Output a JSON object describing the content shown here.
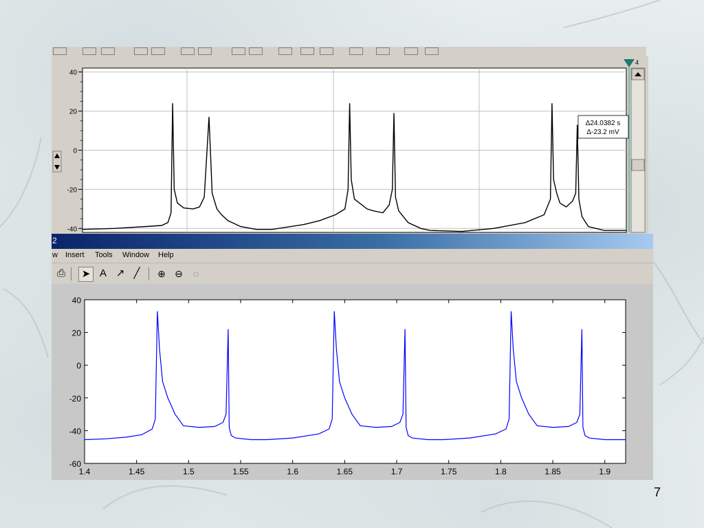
{
  "slide": {
    "number": "7"
  },
  "top_window": {
    "cursor_number": "4",
    "measurement": {
      "dt": "Δ24.0382 s",
      "dv": "Δ-23.2 mV"
    }
  },
  "matlab_window": {
    "title": "2",
    "menu": [
      "w",
      "Insert",
      "Tools",
      "Window",
      "Help"
    ],
    "toolbar": [
      "print-icon",
      "select-arrow-icon",
      "text-icon",
      "arrow-icon",
      "line-icon",
      "zoom-in-icon",
      "zoom-out-icon",
      "rotate-icon"
    ]
  },
  "chart_data": [
    {
      "type": "line",
      "title": "",
      "xlabel": "",
      "ylabel": "",
      "ylim": [
        -42,
        42
      ],
      "yticks": [
        40,
        20,
        0,
        -20,
        -40
      ],
      "grid": true,
      "color": "#000000",
      "x": [
        0.0,
        0.1,
        0.2,
        0.25,
        0.27,
        0.28,
        0.285,
        0.29,
        0.3,
        0.32,
        0.35,
        0.37,
        0.385,
        0.4,
        0.41,
        0.425,
        0.44,
        0.46,
        0.5,
        0.55,
        0.6,
        0.7,
        0.75,
        0.8,
        0.83,
        0.84,
        0.845,
        0.85,
        0.86,
        0.9,
        0.92,
        0.95,
        0.97,
        0.98,
        0.985,
        0.99,
        1.0,
        1.03,
        1.07,
        1.1,
        1.2,
        1.3,
        1.4,
        1.46,
        1.48,
        1.485,
        1.49,
        1.5,
        1.51,
        1.53,
        1.55,
        1.56,
        1.565,
        1.57,
        1.58,
        1.6,
        1.65,
        1.7,
        1.72
      ],
      "y": [
        -40.5,
        -40,
        -39,
        -38.5,
        -37,
        -32,
        24,
        -20,
        -27,
        -29.5,
        -30,
        -29,
        -24,
        17,
        -22,
        -30,
        -33,
        -36,
        -39,
        -40.5,
        -40.5,
        -38,
        -36,
        -33,
        -30,
        -20,
        24,
        -15,
        -25,
        -30,
        -31,
        -32,
        -28,
        -20,
        19,
        -24,
        -31,
        -37,
        -40,
        -41,
        -41.5,
        -40,
        -37,
        -33,
        -25,
        24,
        -15,
        -22,
        -27,
        -29,
        -26,
        -22,
        13,
        -25,
        -34,
        -39,
        -41,
        -41,
        -41
      ]
    },
    {
      "type": "line",
      "title": "",
      "xlabel": "",
      "ylabel": "",
      "xlim": [
        1.4,
        1.92
      ],
      "ylim": [
        -60,
        40
      ],
      "xticks": [
        "1.4",
        "1.45",
        "1.5",
        "1.55",
        "1.6",
        "1.65",
        "1.7",
        "1.75",
        "1.8",
        "1.85",
        "1.9"
      ],
      "yticks": [
        "40",
        "20",
        "0",
        "-20",
        "-40",
        "-60"
      ],
      "grid": false,
      "color": "#0000ff",
      "x": [
        1.4,
        1.42,
        1.44,
        1.455,
        1.465,
        1.468,
        1.47,
        1.472,
        1.475,
        1.48,
        1.487,
        1.495,
        1.51,
        1.525,
        1.533,
        1.536,
        1.538,
        1.539,
        1.541,
        1.545,
        1.56,
        1.575,
        1.6,
        1.625,
        1.635,
        1.638,
        1.64,
        1.642,
        1.645,
        1.65,
        1.657,
        1.665,
        1.68,
        1.695,
        1.703,
        1.706,
        1.708,
        1.709,
        1.711,
        1.715,
        1.73,
        1.745,
        1.77,
        1.795,
        1.805,
        1.808,
        1.81,
        1.812,
        1.815,
        1.82,
        1.827,
        1.835,
        1.85,
        1.865,
        1.873,
        1.876,
        1.878,
        1.879,
        1.881,
        1.885,
        1.9,
        1.92
      ],
      "y": [
        -45.5,
        -45,
        -44,
        -42.5,
        -39,
        -33,
        33,
        10,
        -10,
        -20,
        -30,
        -37,
        -38,
        -37.5,
        -35,
        -30,
        22,
        -38,
        -43,
        -44.5,
        -45.5,
        -45.5,
        -44.5,
        -42,
        -39,
        -33,
        33,
        10,
        -10,
        -20,
        -30,
        -37,
        -38,
        -37.5,
        -35,
        -30,
        22,
        -38,
        -43,
        -44.5,
        -45.5,
        -45.5,
        -44.5,
        -42,
        -39,
        -33,
        33,
        10,
        -10,
        -20,
        -30,
        -37,
        -38,
        -37.5,
        -35,
        -30,
        22,
        -38,
        -43,
        -44.5,
        -45.5,
        -45.5
      ]
    }
  ]
}
